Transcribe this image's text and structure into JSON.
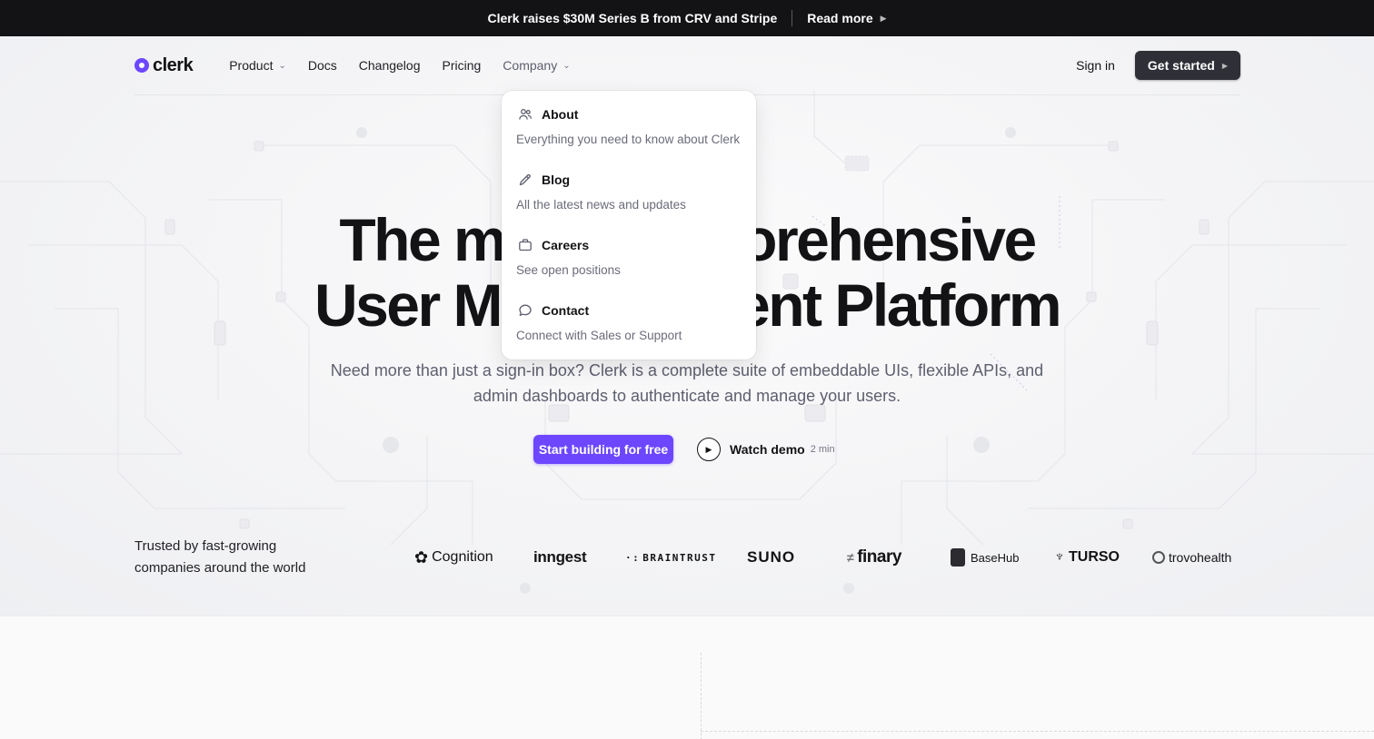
{
  "announcement": {
    "text": "Clerk raises $30M Series B from CRV and Stripe",
    "link_label": "Read more"
  },
  "nav": {
    "logo_text": "clerk",
    "links": [
      {
        "label": "Product"
      },
      {
        "label": "Docs"
      },
      {
        "label": "Changelog"
      },
      {
        "label": "Pricing"
      },
      {
        "label": "Company"
      }
    ],
    "sign_in": "Sign in",
    "get_started": "Get started"
  },
  "company_menu": {
    "items": [
      {
        "title": "About",
        "description": "Everything you need to know about Clerk",
        "icon": "users-icon"
      },
      {
        "title": "Blog",
        "description": "All the latest news and updates",
        "icon": "pencil-icon"
      },
      {
        "title": "Careers",
        "description": "See open positions",
        "icon": "briefcase-icon"
      },
      {
        "title": "Contact",
        "description": "Connect with Sales or Support",
        "icon": "chat-bubble-icon"
      }
    ]
  },
  "hero": {
    "headline_line1_left": "The m",
    "headline_line1_right": "orehensive",
    "headline_line2_left": "User M",
    "headline_line2_right": "ent Platform",
    "subtitle": "Need more than just a sign-in box? Clerk is a complete suite of embeddable UIs, flexible APIs, and admin dashboards to authenticate and manage your users.",
    "primary_cta": "Start building for free",
    "watch_demo": "Watch demo",
    "watch_time": "2 min"
  },
  "trusted": {
    "text": "Trusted by fast-growing companies around the world",
    "logos": [
      "Cognition",
      "inngest",
      "BRAINTRUST",
      "SUNO",
      "finary",
      "BaseHub",
      "TURSO",
      "trovohealth"
    ]
  },
  "colors": {
    "accent": "#6c47ff",
    "dark": "#131316",
    "button_dark": "#2f3037"
  }
}
